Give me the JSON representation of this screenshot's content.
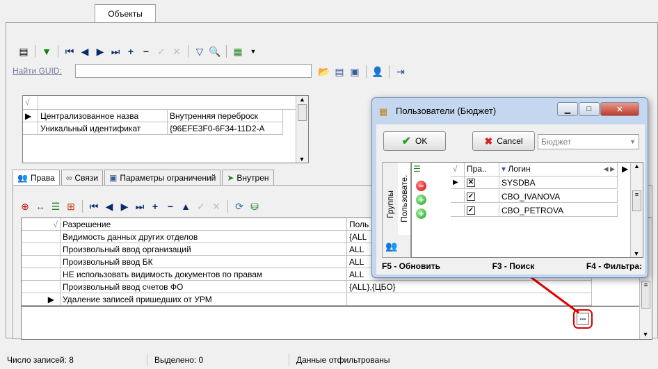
{
  "top_tab": {
    "label": "Объекты"
  },
  "guid": {
    "label": "Найти GUID:",
    "value": ""
  },
  "upper_grid": {
    "rows": [
      {
        "name": "Централизованное назва",
        "value": "Внутренняя переброск"
      },
      {
        "name": "Уникальный идентификат",
        "value": "{96EFE3F0-6F34-11D2-A"
      }
    ]
  },
  "tabs": [
    {
      "label": "Права"
    },
    {
      "label": "Связи"
    },
    {
      "label": "Параметры ограничений"
    },
    {
      "label": "Внутрен"
    }
  ],
  "rights_grid": {
    "col_permission": "Разрешение",
    "col_users": "Поль",
    "rows": [
      {
        "permission": "Видимость данных других отделов",
        "users": "{ALL"
      },
      {
        "permission": "Произвольный ввод организаций",
        "users": "ALL"
      },
      {
        "permission": "Произвольный ввод БК",
        "users": "ALL"
      },
      {
        "permission": "НЕ использовать видимость документов по правам",
        "users": "ALL"
      },
      {
        "permission": "Произвольный ввод счетов ФО",
        "users": "{ALL},{ЦБО}"
      },
      {
        "permission": "Удаление записей пришедших от УРМ",
        "users": ""
      }
    ],
    "ellipsis_label": "..."
  },
  "status": {
    "count": "Число записей:  8",
    "selected": "Выделено:  0",
    "filter": "Данные отфильтрованы"
  },
  "dialog": {
    "title": "Пользователи (Бюджет)",
    "ok_label": "OK",
    "cancel_label": "Cancel",
    "combo_value": "Бюджет",
    "vtab_groups": "Группы",
    "vtab_users": "Пользовате.",
    "col_rights": "Пра..",
    "col_login": "Логин",
    "users": [
      {
        "login": "SYSDBA",
        "checked": "x"
      },
      {
        "login": "CBO_IVANOVA",
        "checked": "v"
      },
      {
        "login": "CBO_PETROVA",
        "checked": "v"
      }
    ],
    "footer": {
      "refresh": "F5 - Обновить",
      "search": "F3 - Поиск",
      "filter": "F4 - Фильтра:"
    }
  },
  "colors": {
    "highlight": "#e00000",
    "dialog_bg": "#c4d7ee"
  }
}
